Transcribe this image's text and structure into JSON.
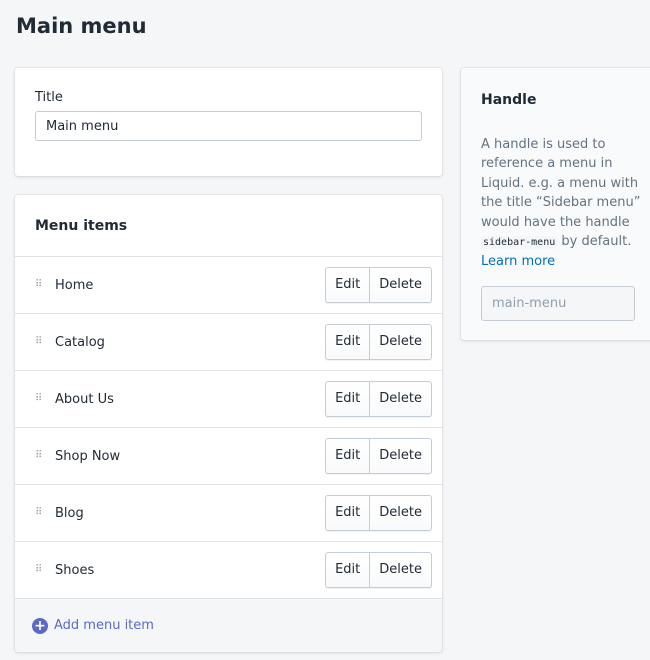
{
  "page_title": "Main menu",
  "title_card": {
    "label": "Title",
    "value": "Main menu"
  },
  "menu_items": {
    "heading": "Menu items",
    "edit_label": "Edit",
    "delete_label": "Delete",
    "items": [
      "Home",
      "Catalog",
      "About Us",
      "Shop Now",
      "Blog",
      "Shoes"
    ],
    "add_label": "Add menu item"
  },
  "handle": {
    "heading": "Handle",
    "desc_before": "A handle is used to reference a menu in Liquid. e.g. a menu with the title “Sidebar menu” would have the handle ",
    "code": "sidebar-menu",
    "desc_after": " by default.",
    "link": "Learn more",
    "value": "main-menu"
  },
  "colors": {
    "accent": "#5c6ac4",
    "link": "#006fbb"
  }
}
